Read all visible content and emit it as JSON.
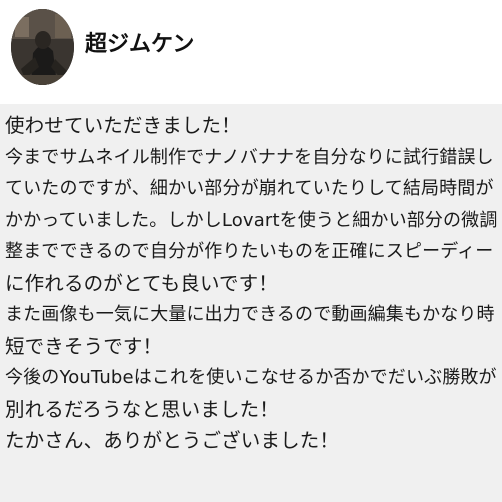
{
  "user": {
    "name": "超ジムケン",
    "avatar_icon": "user-avatar-photo"
  },
  "message": {
    "lines": [
      "使わせていただきました！",
      "今までサムネイル制作でナノバナナを自分なりに試行錯誤し",
      "ていたのですが、細かい部分が崩れていたりして結局時間が",
      "かかっていました。しかしLovartを使うと細かい部分の微調",
      "整までできるので自分が作りたいものを正確にスピーディー",
      "に作れるのがとても良いです！",
      "また画像も一気に大量に出力できるので動画編集もかなり時",
      "短できそうです！",
      "今後のYouTubeはこれを使いこなせるか否かでだいぶ勝敗が",
      "別れるだろうなと思いました！",
      "たかさん、ありがとうございました！"
    ]
  },
  "colors": {
    "header_background": "#ffffff",
    "message_background": "#f0f0f0",
    "text": "#1a1a1a"
  }
}
